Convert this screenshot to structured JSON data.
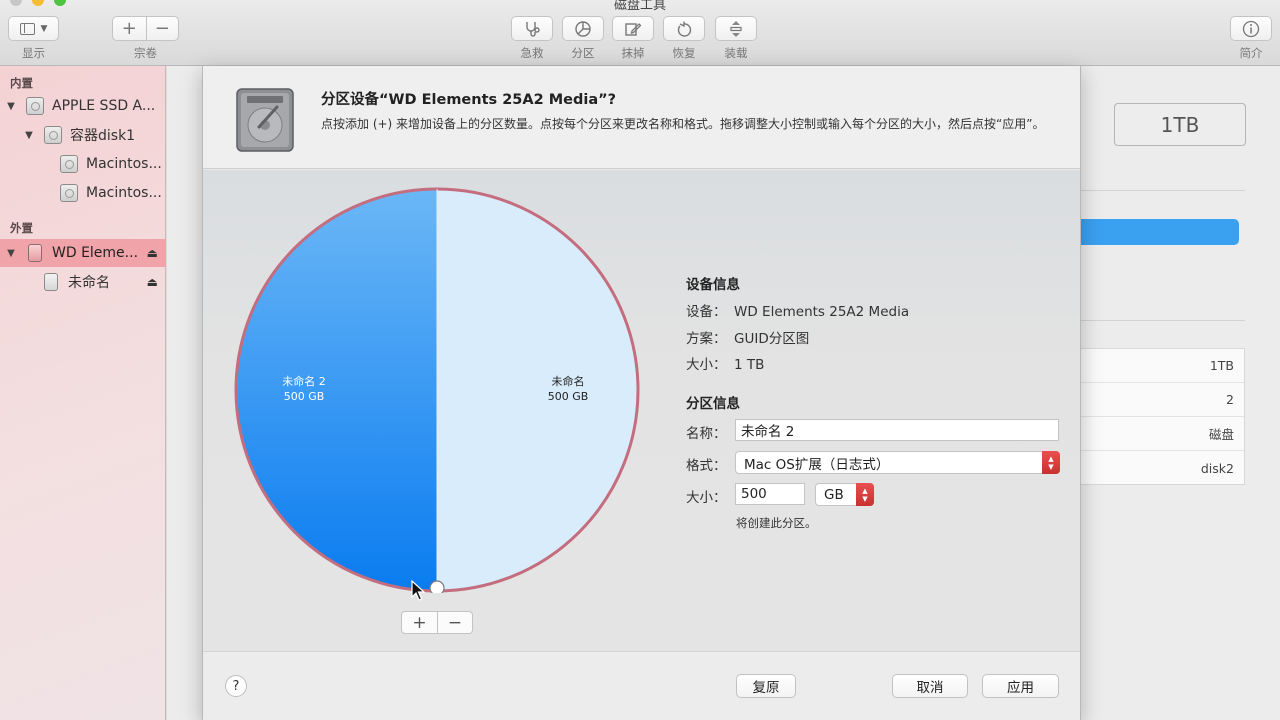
{
  "window": {
    "title": "磁盘工具"
  },
  "toolbar": {
    "view_label": "显示",
    "volume_label": "宗卷",
    "firstaid_label": "急救",
    "partition_label": "分区",
    "erase_label": "抹掉",
    "restore_label": "恢复",
    "mount_label": "装载",
    "info_label": "简介"
  },
  "sidebar": {
    "internal_header": "内置",
    "external_header": "外置",
    "items": [
      {
        "label": "APPLE SSD A..."
      },
      {
        "label": "容器disk1"
      },
      {
        "label": "Macintos..."
      },
      {
        "label": "Macintos..."
      },
      {
        "label": "WD Eleme..."
      },
      {
        "label": "未命名"
      }
    ]
  },
  "main": {
    "capacity": "1TB",
    "table": [
      "1TB",
      "2",
      "磁盘",
      "disk2"
    ]
  },
  "sheet": {
    "title": "分区设备“WD Elements 25A2 Media”?",
    "description": "点按添加 (+) 来增加设备上的分区数量。点按每个分区来更改名称和格式。拖移调整大小控制或输入每个分区的大小，然后点按“应用”。",
    "pie": {
      "slices": [
        {
          "name": "未命名 2",
          "size": "500 GB",
          "fraction": 0.5,
          "color": "#1a87f0"
        },
        {
          "name": "未命名",
          "size": "500 GB",
          "fraction": 0.5,
          "color": "#d9ecfb"
        }
      ]
    },
    "device_info": {
      "title": "设备信息",
      "device_key": "设备：",
      "device_value": "WD Elements 25A2 Media",
      "scheme_key": "方案：",
      "scheme_value": "GUID分区图",
      "size_key": "大小：",
      "size_value": "1 TB"
    },
    "partition_info": {
      "title": "分区信息",
      "name_key": "名称：",
      "name_value": "未命名 2",
      "format_key": "格式：",
      "format_value": "Mac OS扩展（日志式）",
      "size_key": "大小：",
      "size_value": "500",
      "unit_value": "GB",
      "note": "将创建此分区。"
    },
    "buttons": {
      "help": "?",
      "revert": "复原",
      "cancel": "取消",
      "apply": "应用",
      "add": "+",
      "remove": "−"
    }
  },
  "colors": {
    "accent": "#1a87f0",
    "sidebar_selection": "#f0a3a8",
    "popup_stepper": "#d63a3a"
  }
}
